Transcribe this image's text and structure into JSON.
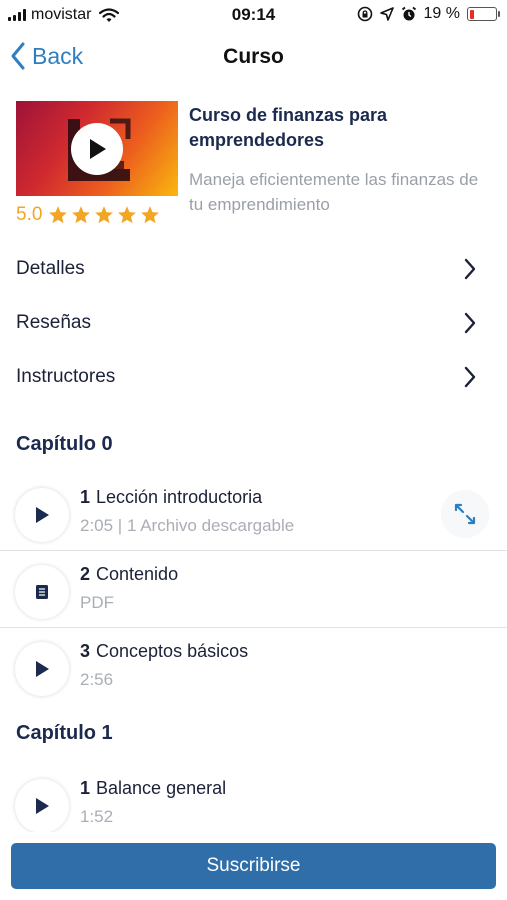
{
  "status_bar": {
    "carrier": "movistar",
    "time": "09:14",
    "battery_text": "19 %",
    "battery_level": 0.19,
    "icons": [
      "signal-icon",
      "wifi-icon",
      "rotation-lock-icon",
      "location-icon",
      "alarm-icon",
      "battery-icon"
    ]
  },
  "nav": {
    "back_label": "Back",
    "title": "Curso"
  },
  "course": {
    "title": "Curso de finanzas para emprendedores",
    "subtitle": "Maneja eficientemente las finanzas de tu emprendimiento",
    "rating": "5.0",
    "stars": 5
  },
  "menu": [
    {
      "label": "Detalles"
    },
    {
      "label": "Reseñas"
    },
    {
      "label": "Instructores"
    }
  ],
  "chapters": [
    {
      "title": "Capítulo 0",
      "lessons": [
        {
          "number": "1",
          "title": "Lección introductoria",
          "meta": "2:05 | 1 Archivo descargable",
          "icon": "play-icon"
        },
        {
          "number": "2",
          "title": "Contenido",
          "meta": "PDF",
          "icon": "document-icon"
        },
        {
          "number": "3",
          "title": "Conceptos básicos",
          "meta": "2:56",
          "icon": "play-icon"
        }
      ]
    },
    {
      "title": "Capítulo 1",
      "lessons": [
        {
          "number": "1",
          "title": "Balance general",
          "meta": "1:52",
          "icon": "play-icon"
        }
      ]
    }
  ],
  "subscribe_label": "Suscribirse",
  "colors": {
    "accent": "#2e7fc1",
    "button": "#2f6ea9",
    "star": "#f2a623",
    "navy": "#1b2a4e",
    "muted": "#9a9fa8"
  }
}
